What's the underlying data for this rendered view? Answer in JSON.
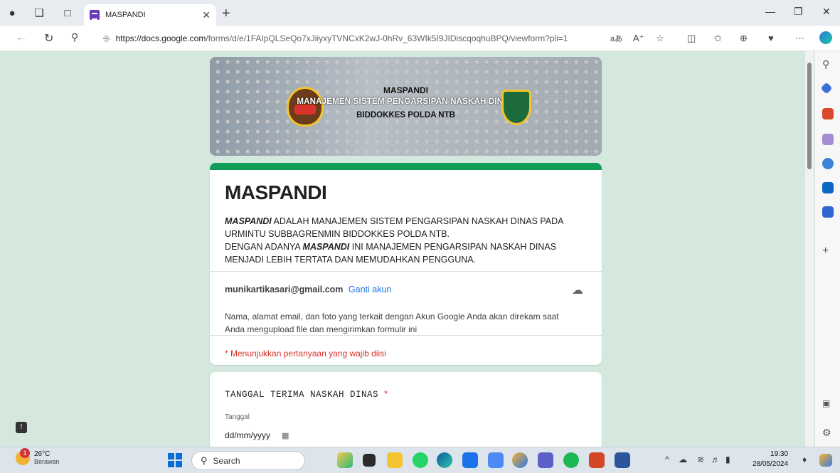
{
  "browser": {
    "tab_title": "MASPANDI",
    "url_host": "https://docs.google.com",
    "url_path": "/forms/d/e/1FAIpQLSeQo7xJiiyxyTVNCxK2wJ-0hRv_63WIk5I9JIDiscqoqhuBPQ/viewform?pli=1"
  },
  "banner": {
    "title": "MASPANDI",
    "subtitle": "MANAJEMEN SISTEM PENGARSIPAN NASKAH DINAS",
    "subtitle2": "BIDDOKKES POLDA NTB"
  },
  "form": {
    "title": "MASPANDI",
    "desc_bold1": "MASPANDI",
    "desc_text1": " ADALAH  MANAJEMEN SISTEM PENGARSIPAN NASKAH DINAS PADA URMINTU SUBBAGRENMIN BIDDOKKES POLDA NTB.",
    "desc_text2": "DENGAN ADANYA ",
    "desc_bold2": "MASPANDI",
    "desc_text3": " INI MANAJEMEN PENGARSIPAN NASKAH DINAS MENJADI LEBIH TERTATA DAN MEMUDAHKAN PENGGUNA.",
    "account_email": "munikartikasari@gmail.com",
    "switch_account": "Ganti akun",
    "notice": "Nama, alamat email, dan foto yang terkait dengan Akun Google Anda akan direkam saat Anda mengupload file dan mengirimkan formulir ini",
    "required_note": "* Menunjukkan pertanyaan yang wajib diisi"
  },
  "question": {
    "title": "TANGGAL TERIMA NASKAH DINAS",
    "required_mark": "*",
    "sublabel": "Tanggal",
    "placeholder": "dd/mm/yyyy"
  },
  "taskbar": {
    "temperature": "26°C",
    "condition": "Berawan",
    "weather_badge": "1",
    "search_placeholder": "Search",
    "time": "19:30",
    "date": "28/05/2024"
  }
}
